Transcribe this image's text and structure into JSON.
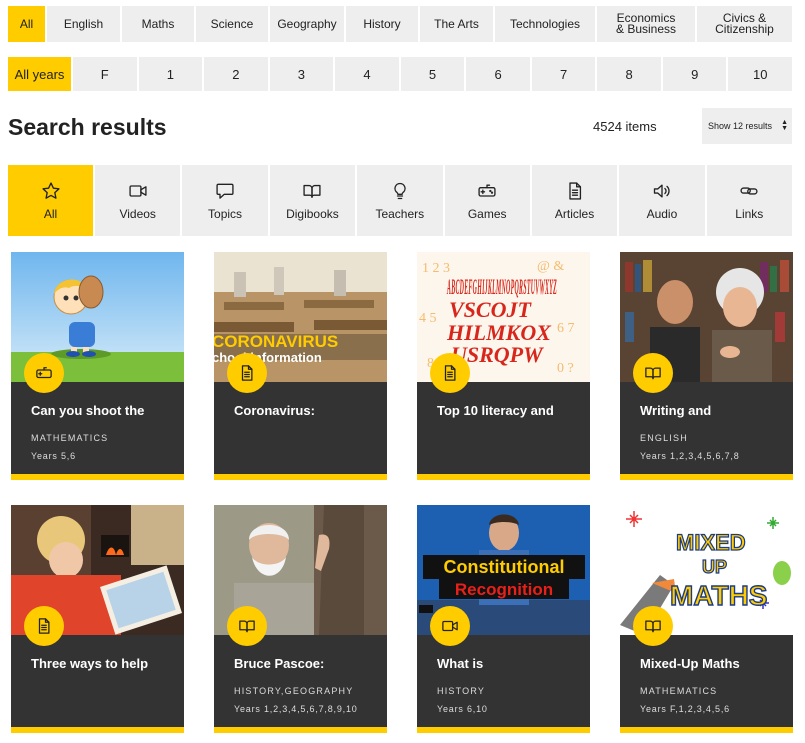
{
  "subjects": [
    {
      "label": "All",
      "active": true
    },
    {
      "label": "English"
    },
    {
      "label": "Maths"
    },
    {
      "label": "Science"
    },
    {
      "label": "Geography"
    },
    {
      "label": "History"
    },
    {
      "label": "The Arts"
    },
    {
      "label": "Technologies"
    },
    {
      "label": "Economics & Business"
    },
    {
      "label": "Civics & Citizenship"
    }
  ],
  "years": [
    "All years",
    "F",
    "1",
    "2",
    "3",
    "4",
    "5",
    "6",
    "7",
    "8",
    "9",
    "10"
  ],
  "results": {
    "title": "Search results",
    "count": "4524 items",
    "show_label": "Show 12 results"
  },
  "types": [
    {
      "label": "All",
      "icon": "star-icon"
    },
    {
      "label": "Videos",
      "icon": "video-icon"
    },
    {
      "label": "Topics",
      "icon": "speech-bubble-icon"
    },
    {
      "label": "Digibooks",
      "icon": "book-icon"
    },
    {
      "label": "Teachers",
      "icon": "lightbulb-icon"
    },
    {
      "label": "Games",
      "icon": "gamepad-icon"
    },
    {
      "label": "Articles",
      "icon": "document-icon"
    },
    {
      "label": "Audio",
      "icon": "speaker-icon"
    },
    {
      "label": "Links",
      "icon": "link-icon"
    }
  ],
  "cards": [
    {
      "title": "Can you shoot the",
      "subject": "Mathematics",
      "years": "Years 5,6",
      "type_icon": "gamepad-icon"
    },
    {
      "title": "Coronavirus:",
      "subject": "",
      "years": "",
      "type_icon": "document-icon",
      "thumb_text_1": "CORONAVIRUS",
      "thumb_text_2": "chool information"
    },
    {
      "title": "Top 10 literacy and",
      "subject": "",
      "years": "",
      "type_icon": "document-icon",
      "thumb_text_1": "ABCDEFGHIJKLMNOPQRSTUVWXYZ"
    },
    {
      "title": "Writing and",
      "subject": "English",
      "years": "Years 1,2,3,4,5,6,7,8",
      "type_icon": "book-icon"
    },
    {
      "title": "Three ways to help",
      "subject": "",
      "years": "",
      "type_icon": "document-icon"
    },
    {
      "title": "Bruce Pascoe:",
      "subject": "History,Geography",
      "years": "Years 1,2,3,4,5,6,7,8,9,10",
      "type_icon": "book-icon"
    },
    {
      "title": "What is",
      "subject": "History",
      "years": "Years 6,10",
      "type_icon": "video-icon",
      "thumb_text_1": "Constitutional",
      "thumb_text_2": "Recognition"
    },
    {
      "title": "Mixed-Up Maths",
      "subject": "Mathematics",
      "years": "Years F,1,2,3,4,5,6",
      "type_icon": "book-icon",
      "thumb_text_1": "MIXED",
      "thumb_text_2": "UP",
      "thumb_text_3": "MATHS"
    }
  ],
  "colors": {
    "accent": "#ffcc00",
    "card_bg": "#333333",
    "tab_bg": "#eeeeee"
  }
}
